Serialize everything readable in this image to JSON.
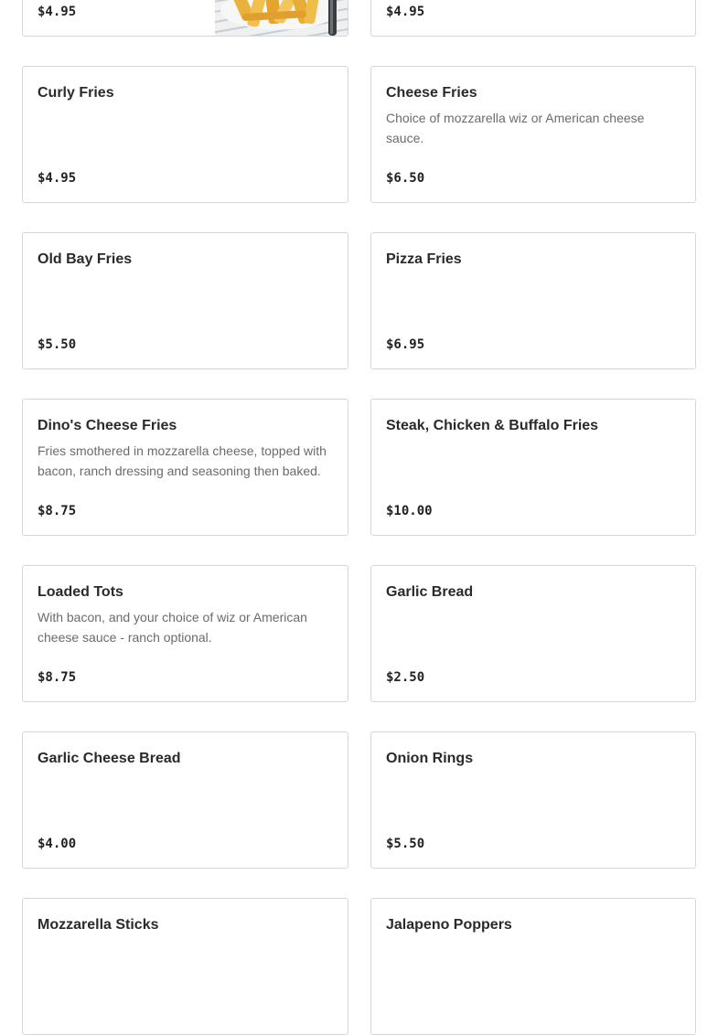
{
  "menu": {
    "items": [
      {
        "name": "",
        "description": "",
        "price": "$4.95",
        "image_icon": "fries-photo"
      },
      {
        "name": "",
        "description": "",
        "price": "$4.95"
      },
      {
        "name": "Curly Fries",
        "description": "",
        "price": "$4.95"
      },
      {
        "name": "Cheese Fries",
        "description": "Choice of mozzarella wiz or American cheese sauce.",
        "price": "$6.50"
      },
      {
        "name": "Old Bay Fries",
        "description": "",
        "price": "$5.50"
      },
      {
        "name": "Pizza Fries",
        "description": "",
        "price": "$6.95"
      },
      {
        "name": "Dino's Cheese Fries",
        "description": "Fries smothered in mozzarella cheese, topped with bacon, ranch dressing and seasoning then baked.",
        "price": "$8.75"
      },
      {
        "name": "Steak, Chicken & Buffalo Fries",
        "description": "",
        "price": "$10.00"
      },
      {
        "name": "Loaded Tots",
        "description": "With bacon, and your choice of wiz or American cheese sauce - ranch optional.",
        "price": "$8.75"
      },
      {
        "name": "Garlic Bread",
        "description": "",
        "price": "$2.50"
      },
      {
        "name": "Garlic Cheese Bread",
        "description": "",
        "price": "$4.00"
      },
      {
        "name": "Onion Rings",
        "description": "",
        "price": "$5.50"
      },
      {
        "name": "Mozzarella Sticks",
        "description": "",
        "price": ""
      },
      {
        "name": "Jalapeno Poppers",
        "description": "",
        "price": ""
      }
    ]
  }
}
